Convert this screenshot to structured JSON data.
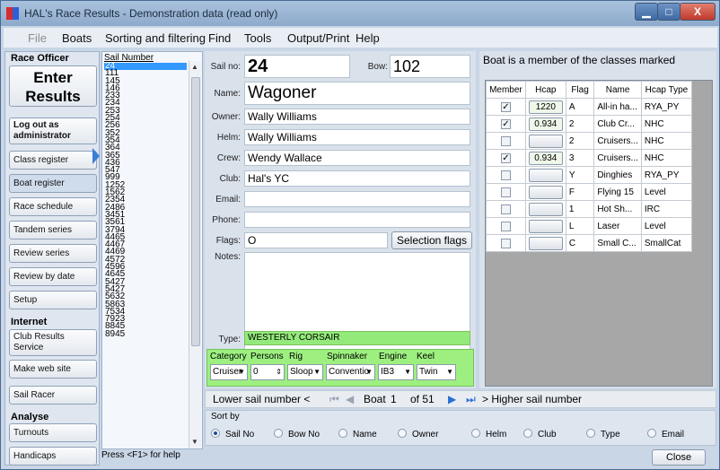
{
  "window": {
    "title": "HAL's Race Results - Demonstration data (read only)",
    "min": "▁",
    "max": "□",
    "close": "X"
  },
  "menu": [
    {
      "label": "File",
      "disabled": true
    },
    {
      "label": "Boats"
    },
    {
      "label": "Sorting and filtering"
    },
    {
      "label": "Find"
    },
    {
      "label": "Tools"
    },
    {
      "label": "Output/Print"
    },
    {
      "label": "Help"
    }
  ],
  "left": {
    "race_officer": "Race Officer",
    "enter_results": "Enter Results",
    "logout": "Log out as administrator",
    "buttons": [
      "Class register",
      "Boat register",
      "Race schedule",
      "Tandem series",
      "Review series",
      "Review by date",
      "Setup"
    ],
    "internet": "Internet",
    "internet_buttons": [
      "Club Results Service",
      "Make web site",
      "Sail Racer"
    ],
    "analyse": "Analyse",
    "analyse_buttons": [
      "Turnouts",
      "Handicaps"
    ]
  },
  "sail": {
    "header": "Sail Number",
    "items": [
      "24",
      "111",
      "145",
      "146",
      "233",
      "234",
      "253",
      "254",
      "256",
      "352",
      "354",
      "364",
      "365",
      "436",
      "547",
      "999",
      "1252",
      "1562",
      "2354",
      "2486",
      "3451",
      "3561",
      "3794",
      "4465",
      "4467",
      "4469",
      "4572",
      "4596",
      "4645",
      "5427",
      "5427",
      "5632",
      "5863",
      "7534",
      "7923",
      "8845",
      "8945"
    ]
  },
  "status": "Press <F1> for help",
  "form": {
    "sail_label": "Sail no:",
    "sail_no": "24",
    "bow_label": "Bow:",
    "bow_no": "102",
    "name_label": "Name:",
    "name": "Wagoner",
    "owner_label": "Owner:",
    "owner": "Wally Williams",
    "helm_label": "Helm:",
    "helm": "Wally Williams",
    "crew_label": "Crew:",
    "crew": "Wendy Wallace",
    "club_label": "Club:",
    "club": "Hal's YC",
    "email_label": "Email:",
    "email": "",
    "phone_label": "Phone:",
    "phone": "",
    "flags_label": "Flags:",
    "flags": "O",
    "selection_flags": "Selection flags",
    "notes_label": "Notes:",
    "type_label": "Type:",
    "type": "WESTERLY CORSAIR"
  },
  "category": {
    "headers": [
      "Category",
      "Persons",
      "Rig",
      "Spinnaker",
      "Engine",
      "Keel"
    ],
    "values": [
      "Cruiser",
      "0",
      "Sloop",
      "Conventio",
      "IB3",
      "Twin"
    ]
  },
  "classes": {
    "title": "Boat is a member of the classes marked",
    "columns": [
      "Member",
      "Hcap",
      "Flag",
      "Name",
      "Hcap Type"
    ],
    "rows": [
      {
        "member": true,
        "hcap": "1220",
        "flag": "A",
        "name": "All-in ha...",
        "type": "RYA_PY"
      },
      {
        "member": true,
        "hcap": "0.934",
        "flag": "2",
        "name": "Club Cr...",
        "type": "NHC"
      },
      {
        "member": false,
        "hcap": "",
        "flag": "2",
        "name": "Cruisers...",
        "type": "NHC"
      },
      {
        "member": true,
        "hcap": "0.934",
        "flag": "3",
        "name": "Cruisers...",
        "type": "NHC"
      },
      {
        "member": false,
        "hcap": "",
        "flag": "Y",
        "name": "Dinghies",
        "type": "RYA_PY"
      },
      {
        "member": false,
        "hcap": "",
        "flag": "F",
        "name": "Flying 15",
        "type": "Level"
      },
      {
        "member": false,
        "hcap": "",
        "flag": "1",
        "name": "Hot Sh...",
        "type": "IRC"
      },
      {
        "member": false,
        "hcap": "",
        "flag": "L",
        "name": "Laser",
        "type": "Level"
      },
      {
        "member": false,
        "hcap": "",
        "flag": "C",
        "name": "Small C...",
        "type": "SmallCat"
      }
    ]
  },
  "nav": {
    "lower": "Lower sail number <",
    "boat_label": "Boat",
    "current": "1",
    "of": "of 51",
    "higher": "> Higher sail number"
  },
  "sort": {
    "label": "Sort by",
    "options": [
      "Sail No",
      "Bow No",
      "Name",
      "Owner",
      "Helm",
      "Club",
      "Type",
      "Email"
    ],
    "selected": "Sail No"
  },
  "close_label": "Close"
}
